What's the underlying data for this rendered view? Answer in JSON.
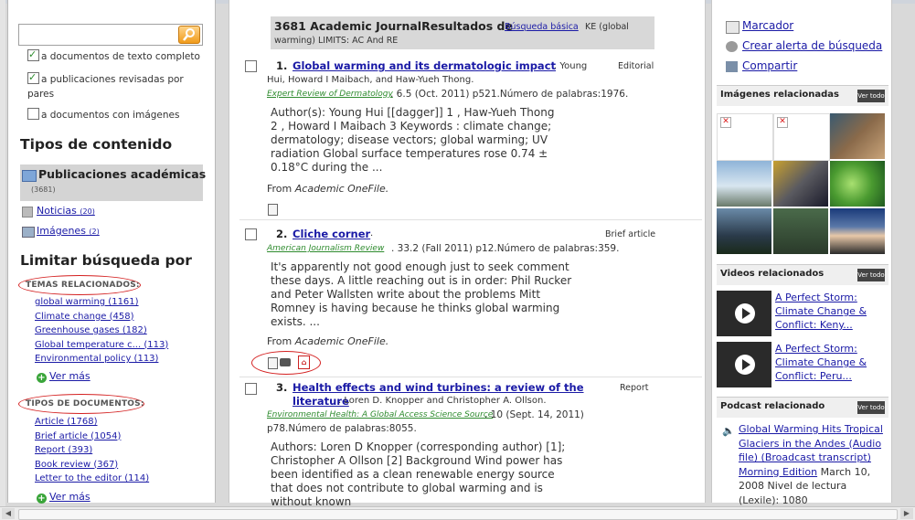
{
  "left": {
    "filters": [
      {
        "label": "a documentos de texto completo",
        "checked": true
      },
      {
        "label": "a publicaciones revisadas por pares",
        "checked": true
      },
      {
        "label": "a documentos con imágenes",
        "checked": false
      }
    ],
    "content_types_heading": "Tipos de contenido",
    "content_types": [
      {
        "label": "Publicaciones académicas",
        "count": "(3681)"
      },
      {
        "label": "Noticias",
        "count": "(20)"
      },
      {
        "label": "Imágenes",
        "count": "(2)"
      }
    ],
    "limit_heading": "Limitar búsqueda por",
    "related_topics_heading": "TEMAS RELACIONADOS:",
    "related_topics": [
      "global warming (1161)",
      "Climate change (458)",
      "Greenhouse gases (182)",
      "Global temperature c... (113)",
      "Environmental policy (113)"
    ],
    "more_label": "Ver más",
    "doc_types_heading": "TIPOS DE DOCUMENTOS:",
    "doc_types": [
      "Article (1768)",
      "Brief article (1054)",
      "Report (393)",
      "Book review (367)",
      "Letter to the editor (114)"
    ]
  },
  "main": {
    "header_title": "3681 Academic JournalResultados de",
    "header_link": "Búsqueda básica",
    "header_rest": "KE (global",
    "header_line2": "warming) LIMITS: AC And RE",
    "results": [
      {
        "num": "1.",
        "title": "Global warming and its dermatologic impact",
        "type": "Editorial",
        "authors_line1": ". Young",
        "authors_line2": "Hui, Howard I Maibach, and Haw-Yueh Thong.",
        "source": "Expert Review of Dermatology",
        "meta": ". 6.5 (Oct. 2011) p521.Número de palabras:1976.",
        "abstract": "Author(s): Young Hui [[dagger]] 1 , Haw-Yueh Thong\n2 , Howard I Maibach 3 Keywords : climate change;\ndermatology; disease vectors; global warming; UV\nradiation Global surface temperatures rose 0.74 ±\n0.18°C during the ...",
        "from_prefix": "From",
        "from_source": "Academic OneFile."
      },
      {
        "num": "2.",
        "title": "Cliche corner",
        "title_suffix": ".",
        "type": "Brief article",
        "source": "American Journalism Review",
        "meta": ". 33.2 (Fall 2011) p12.Número de palabras:359.",
        "abstract": "It's apparently not good enough just to seek comment\nthese days. A little reaching out is in order: Phil Rucker\nand Peter Wallsten write about the problems Mitt\nRomney is having because he thinks global warming\nexists. ...",
        "from_prefix": "From",
        "from_source": "Academic OneFile."
      },
      {
        "num": "3.",
        "title_line1": "Health effects and wind turbines: a review of the",
        "title_line2": "literature",
        "type": "Report",
        "authors_line": ". Loren D. Knopper and Christopher A. Ollson.",
        "source": "Environmental Health: A Global Access Science Source",
        "meta_line1": ". 10 (Sept. 14, 2011)",
        "meta_line2": "p78.Número de palabras:8055.",
        "abstract": "Authors: Loren D Knopper (corresponding author) [1];\nChristopher A Ollson [2] Background Wind power has\nbeen identified as a clean renewable energy source\nthat does not contribute to global warming and is\nwithout known"
      }
    ]
  },
  "right": {
    "links": [
      "Marcador",
      "Crear alerta de búsqueda",
      "Compartir"
    ],
    "images_heading": "Imágenes relacionadas",
    "view_all": "Ver todo",
    "videos_heading": "Videos relacionados",
    "videos": [
      {
        "title": "A Perfect Storm: Climate Change & Conflict: Keny..."
      },
      {
        "title": "A Perfect Storm: Climate Change & Conflict: Peru..."
      }
    ],
    "podcast_heading": "Podcast relacionado",
    "podcast_title": "Global Warming Hits Tropical Glaciers in the Andes (Audio file) (Broadcast transcript) Morning Edition",
    "podcast_meta": "March 10, 2008 Nivel de lectura (Lexile): 1080"
  }
}
